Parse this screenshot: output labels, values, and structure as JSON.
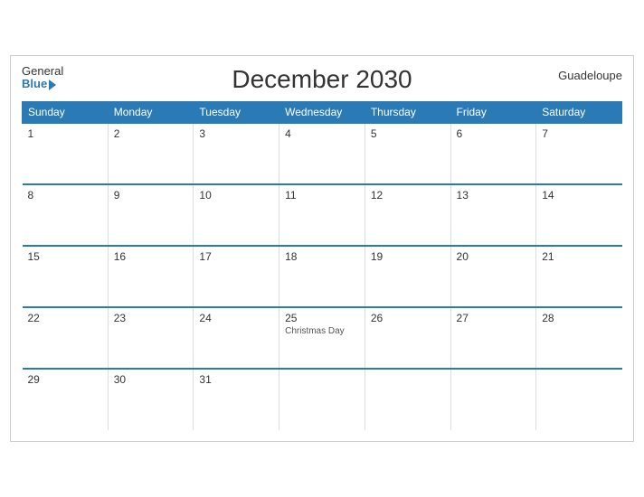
{
  "header": {
    "title": "December 2030",
    "region": "Guadeloupe",
    "logo_general": "General",
    "logo_blue": "Blue"
  },
  "weekdays": [
    "Sunday",
    "Monday",
    "Tuesday",
    "Wednesday",
    "Thursday",
    "Friday",
    "Saturday"
  ],
  "weeks": [
    [
      {
        "day": "1",
        "holiday": ""
      },
      {
        "day": "2",
        "holiday": ""
      },
      {
        "day": "3",
        "holiday": ""
      },
      {
        "day": "4",
        "holiday": ""
      },
      {
        "day": "5",
        "holiday": ""
      },
      {
        "day": "6",
        "holiday": ""
      },
      {
        "day": "7",
        "holiday": ""
      }
    ],
    [
      {
        "day": "8",
        "holiday": ""
      },
      {
        "day": "9",
        "holiday": ""
      },
      {
        "day": "10",
        "holiday": ""
      },
      {
        "day": "11",
        "holiday": ""
      },
      {
        "day": "12",
        "holiday": ""
      },
      {
        "day": "13",
        "holiday": ""
      },
      {
        "day": "14",
        "holiday": ""
      }
    ],
    [
      {
        "day": "15",
        "holiday": ""
      },
      {
        "day": "16",
        "holiday": ""
      },
      {
        "day": "17",
        "holiday": ""
      },
      {
        "day": "18",
        "holiday": ""
      },
      {
        "day": "19",
        "holiday": ""
      },
      {
        "day": "20",
        "holiday": ""
      },
      {
        "day": "21",
        "holiday": ""
      }
    ],
    [
      {
        "day": "22",
        "holiday": ""
      },
      {
        "day": "23",
        "holiday": ""
      },
      {
        "day": "24",
        "holiday": ""
      },
      {
        "day": "25",
        "holiday": "Christmas Day"
      },
      {
        "day": "26",
        "holiday": ""
      },
      {
        "day": "27",
        "holiday": ""
      },
      {
        "day": "28",
        "holiday": ""
      }
    ],
    [
      {
        "day": "29",
        "holiday": ""
      },
      {
        "day": "30",
        "holiday": ""
      },
      {
        "day": "31",
        "holiday": ""
      },
      {
        "day": "",
        "holiday": ""
      },
      {
        "day": "",
        "holiday": ""
      },
      {
        "day": "",
        "holiday": ""
      },
      {
        "day": "",
        "holiday": ""
      }
    ]
  ]
}
